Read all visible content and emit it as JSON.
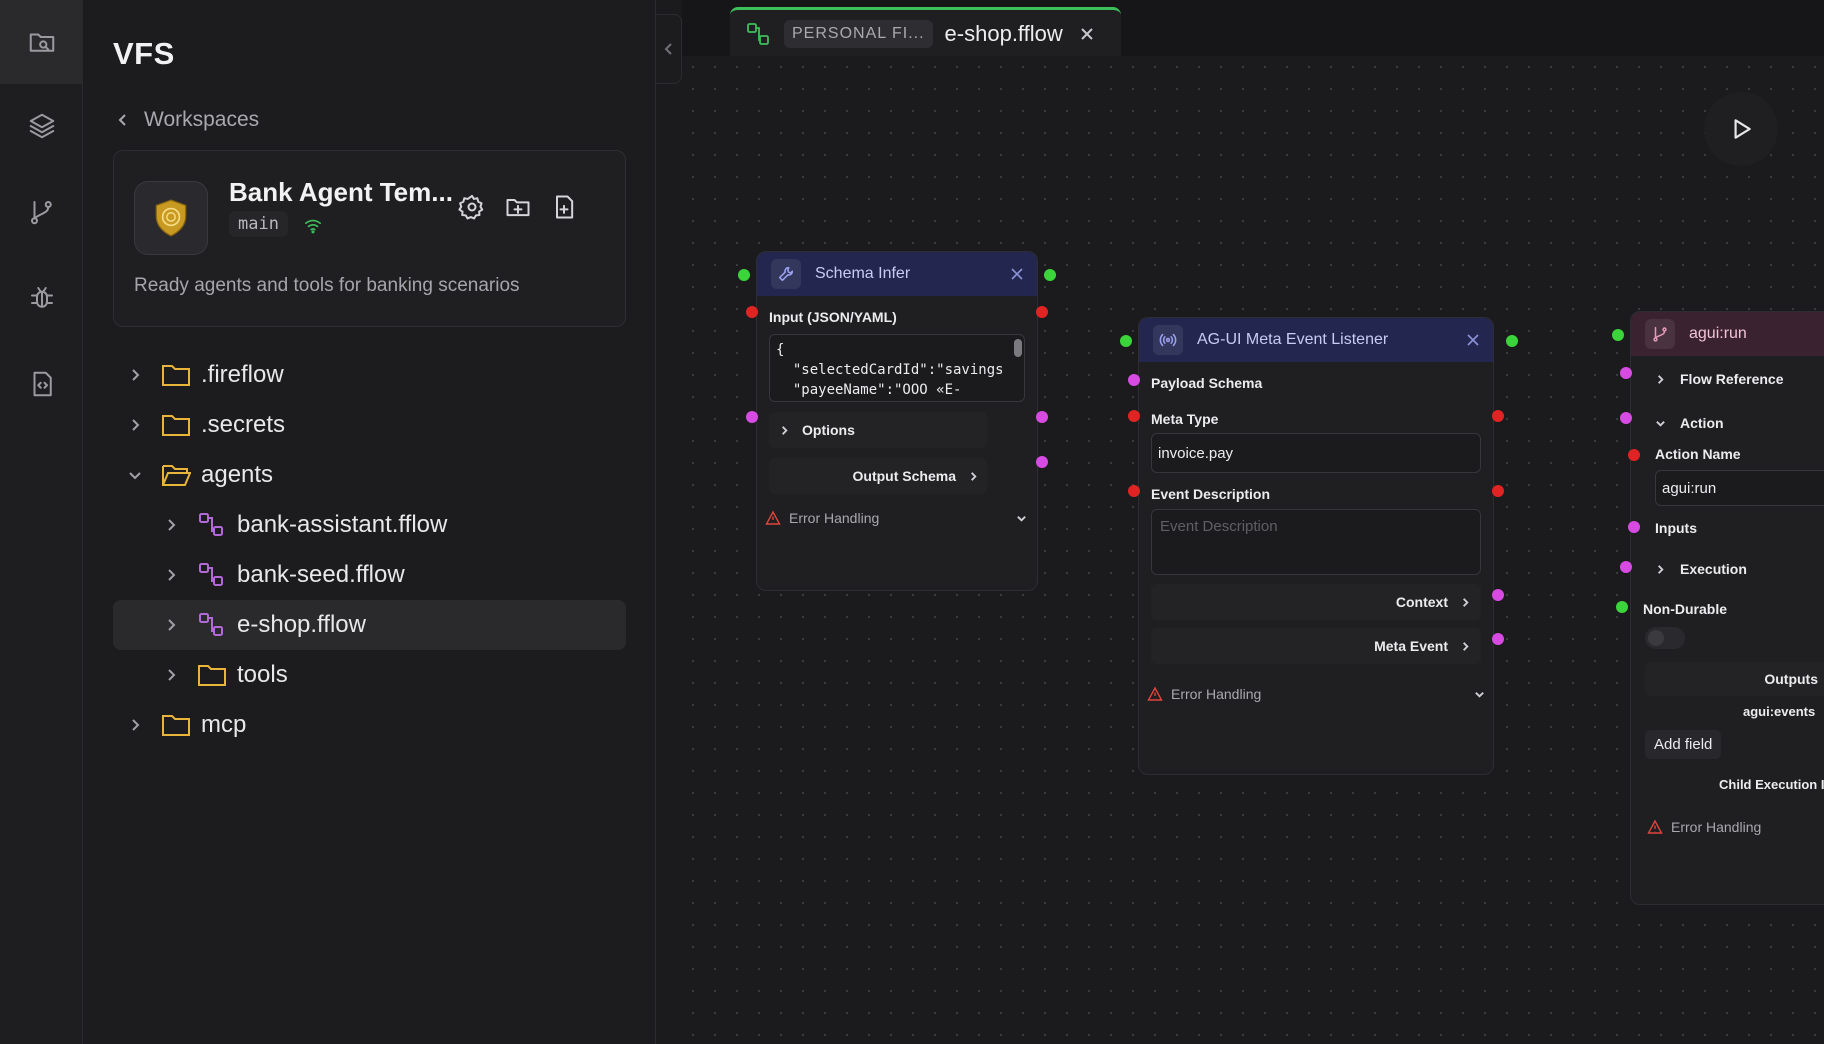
{
  "sidebar": {
    "title": "VFS",
    "back_label": "Workspaces",
    "workspace": {
      "name": "Bank Agent Tem...",
      "branch": "main",
      "description": "Ready agents and tools for banking scenarios"
    },
    "tree": [
      {
        "label": ".fireflow",
        "type": "folder",
        "depth": 0,
        "expanded": false
      },
      {
        "label": ".secrets",
        "type": "folder",
        "depth": 0,
        "expanded": false
      },
      {
        "label": "agents",
        "type": "folder-open",
        "depth": 0,
        "expanded": true
      },
      {
        "label": "bank-assistant.fflow",
        "type": "flow",
        "depth": 1,
        "expanded": false
      },
      {
        "label": "bank-seed.fflow",
        "type": "flow",
        "depth": 1,
        "expanded": false
      },
      {
        "label": "e-shop.fflow",
        "type": "flow",
        "depth": 1,
        "expanded": false,
        "selected": true
      },
      {
        "label": "tools",
        "type": "folder",
        "depth": 1,
        "expanded": false
      },
      {
        "label": "mcp",
        "type": "folder",
        "depth": 0,
        "expanded": false
      }
    ]
  },
  "tab": {
    "crumb": "PERSONAL FI...",
    "title": "e-shop.fflow"
  },
  "nodes": {
    "schema_infer": {
      "title": "Schema Infer",
      "input_label": "Input (JSON/YAML)",
      "input_value": "{\n  \"selectedCardId\":\"savings\",\n  \"payeeName\":\"OOO «E-",
      "options_label": "Options",
      "output_schema_label": "Output Schema",
      "error_label": "Error Handling"
    },
    "agui_listener": {
      "title": "AG-UI Meta Event Listener",
      "payload_label": "Payload Schema",
      "meta_type_label": "Meta Type",
      "meta_type_value": "invoice.pay",
      "event_desc_label": "Event Description",
      "event_desc_placeholder": "Event Description",
      "context_label": "Context",
      "meta_event_label": "Meta Event",
      "error_label": "Error Handling"
    },
    "agui_run": {
      "title": "agui:run",
      "flow_ref_label": "Flow Reference",
      "action_label": "Action",
      "action_name_label": "Action Name",
      "action_name_value": "agui:run",
      "inputs_label": "Inputs",
      "execution_label": "Execution",
      "non_durable_label": "Non-Durable",
      "outputs_label": "Outputs",
      "outputs_value": "agui:events",
      "add_field_label": "Add field",
      "child_exec_label": "Child Execution I",
      "error_label": "Error Handling"
    }
  },
  "colors": {
    "accent_green": "#3fbf5c",
    "port_green": "#3bd43b",
    "port_red": "#e02424",
    "port_pink": "#d74be3",
    "node_head_blue": "#23264f",
    "node_head_pink": "#3a2230",
    "folder_yellow": "#e9b43a",
    "flow_purple": "#b36ad9"
  },
  "icons": {
    "activity": [
      "folder-search-icon",
      "layers-icon",
      "git-branch-icon",
      "bug-icon",
      "code-file-icon"
    ],
    "run": "play-icon"
  }
}
